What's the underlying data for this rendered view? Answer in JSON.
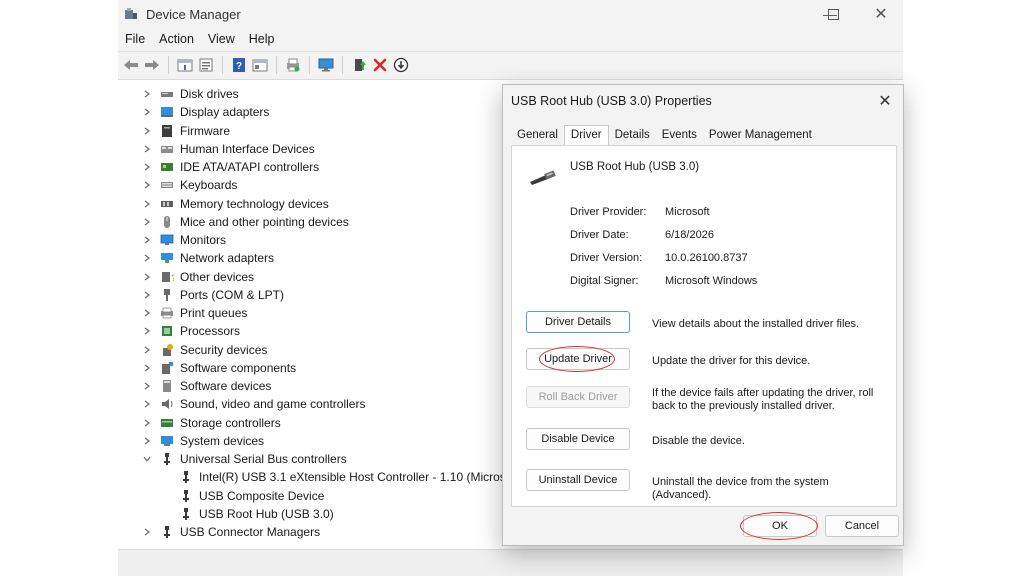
{
  "window": {
    "title": "Device Manager",
    "icon": "device-manager-icon",
    "controls": [
      "minimize-icon",
      "maximize-icon",
      "close-icon"
    ]
  },
  "menu": [
    "File",
    "Action",
    "View",
    "Help"
  ],
  "toolbar": [
    "back-arrow-icon",
    "forward-arrow-icon",
    "properties-icon",
    "show-hidden-icon",
    "help-icon",
    "action-pane-icon",
    "print-icon",
    "monitor-icon",
    "update-driver-icon",
    "uninstall-x-icon",
    "download-icon"
  ],
  "tree": {
    "categories": [
      {
        "label": "Disk drives",
        "icon": "disk-drive-icon",
        "expanded": false
      },
      {
        "label": "Display adapters",
        "icon": "display-adapter-icon",
        "expanded": false
      },
      {
        "label": "Firmware",
        "icon": "firmware-icon",
        "expanded": false
      },
      {
        "label": "Human Interface Devices",
        "icon": "hid-icon",
        "expanded": false
      },
      {
        "label": "IDE ATA/ATAPI controllers",
        "icon": "ide-controller-icon",
        "expanded": false
      },
      {
        "label": "Keyboards",
        "icon": "keyboard-icon",
        "expanded": false
      },
      {
        "label": "Memory technology devices",
        "icon": "memory-icon",
        "expanded": false
      },
      {
        "label": "Mice and other pointing devices",
        "icon": "mouse-icon",
        "expanded": false
      },
      {
        "label": "Monitors",
        "icon": "monitor-icon",
        "expanded": false
      },
      {
        "label": "Network adapters",
        "icon": "network-adapter-icon",
        "expanded": false
      },
      {
        "label": "Other devices",
        "icon": "other-devices-icon",
        "expanded": false
      },
      {
        "label": "Ports (COM & LPT)",
        "icon": "port-icon",
        "expanded": false
      },
      {
        "label": "Print queues",
        "icon": "printer-icon",
        "expanded": false
      },
      {
        "label": "Processors",
        "icon": "processor-icon",
        "expanded": false
      },
      {
        "label": "Security devices",
        "icon": "security-device-icon",
        "expanded": false
      },
      {
        "label": "Software components",
        "icon": "software-component-icon",
        "expanded": false
      },
      {
        "label": "Software devices",
        "icon": "software-device-icon",
        "expanded": false
      },
      {
        "label": "Sound, video and game controllers",
        "icon": "speaker-icon",
        "expanded": false
      },
      {
        "label": "Storage controllers",
        "icon": "storage-controller-icon",
        "expanded": false
      },
      {
        "label": "System devices",
        "icon": "system-device-icon",
        "expanded": false
      },
      {
        "label": "Universal Serial Bus controllers",
        "icon": "usb-icon",
        "expanded": true,
        "children": [
          "Intel(R) USB 3.1 eXtensible Host Controller - 1.10 (Microsoft)",
          "USB Composite Device",
          "USB Root Hub (USB 3.0)"
        ]
      },
      {
        "label": "USB Connector Managers",
        "icon": "usb-icon",
        "expanded": false
      }
    ]
  },
  "dialog": {
    "title": "USB Root Hub (USB 3.0) Properties",
    "tabs": [
      "General",
      "Driver",
      "Details",
      "Events",
      "Power Management"
    ],
    "active_tab": "Driver",
    "device_name": "USB Root Hub (USB 3.0)",
    "device_icon": "usb-plug-icon",
    "info": [
      {
        "label": "Driver Provider:",
        "value": "Microsoft"
      },
      {
        "label": "Driver Date:",
        "value": "6/18/2026"
      },
      {
        "label": "Driver Version:",
        "value": "10.0.26100.8737"
      },
      {
        "label": "Digital Signer:",
        "value": "Microsoft Windows"
      }
    ],
    "actions": [
      {
        "label": "Driver Details",
        "desc": "View details about the installed driver files.",
        "enabled": true
      },
      {
        "label": "Update Driver",
        "desc": "Update the driver for this device.",
        "enabled": true
      },
      {
        "label": "Roll Back Driver",
        "desc": "If the device fails after updating the driver, roll back to the previously installed driver.",
        "enabled": false
      },
      {
        "label": "Disable Device",
        "desc": "Disable the device.",
        "enabled": true
      },
      {
        "label": "Uninstall Device",
        "desc": "Uninstall the device from the system (Advanced).",
        "enabled": true
      }
    ],
    "ok_label": "OK",
    "cancel_label": "Cancel"
  },
  "colors": {
    "highlight_circle": "#d9302c",
    "focus_border": "#5a9bd6",
    "delete_red": "#d42b2b"
  }
}
